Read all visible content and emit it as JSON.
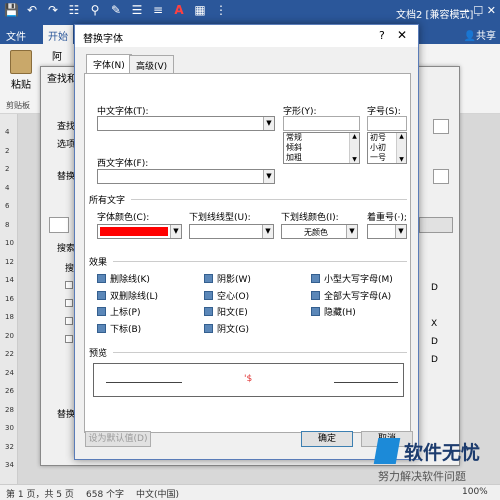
{
  "app": {
    "doc_title": "文档2 [兼容模式] -",
    "qat_icons": [
      "save-icon",
      "undo-icon",
      "redo-icon",
      "print-preview-icon",
      "zoom-icon",
      "format-painter-icon",
      "paragraph-icon",
      "align-icon",
      "font-color-icon",
      "table-icon",
      "more-icon"
    ],
    "font_color_glyph": "A",
    "menu_file": "文件",
    "menu_home": "开始",
    "share": "共享",
    "window_controls": "—  ☐  ✕"
  },
  "ribbon": {
    "paste_label": "粘贴",
    "group_label": "剪贴板",
    "font_hint": "阿"
  },
  "ruler_numbers": [
    "4",
    "2",
    "2",
    "4",
    "6",
    "8",
    "10",
    "12",
    "14",
    "16",
    "18",
    "20",
    "22",
    "24",
    "26",
    "28",
    "30",
    "32",
    "34"
  ],
  "status": {
    "page": "第 1 页，共 5 页",
    "words": "658 个字",
    "lang": "中文(中国)",
    "zoom": "100%"
  },
  "find_replace": {
    "title": "查找和",
    "find_label": "查找",
    "options_label": "选项",
    "replace_label": "替换",
    "search_label": "搜索",
    "search_sub": "搜",
    "replace_bottom": "替换",
    "right_letters": [
      "D",
      "X",
      "D",
      "D"
    ]
  },
  "dialog": {
    "title": "替换字体",
    "help": "?",
    "close": "✕",
    "tabs": [
      "字体(N)",
      "高级(V)"
    ],
    "chinese_font_label": "中文字体(T):",
    "chinese_font_value": "",
    "western_font_label": "西文字体(F):",
    "western_font_value": "",
    "style_label": "字形(Y):",
    "style_value": "",
    "style_options": [
      "常规",
      "倾斜",
      "加粗"
    ],
    "size_label": "字号(S):",
    "size_value": "",
    "size_options": [
      "初号",
      "小初",
      "一号"
    ],
    "all_text_label": "所有文字",
    "font_color_label": "字体颜色(C):",
    "font_color_value": "#ff0000",
    "underline_style_label": "下划线线型(U):",
    "underline_style_value": "",
    "underline_color_label": "下划线颜色(I):",
    "underline_color_value": "无颜色",
    "emphasis_label": "着重号(·);",
    "emphasis_value": "",
    "effects_label": "效果",
    "effects": [
      {
        "label": "删除线(K)",
        "col": 0,
        "row": 0
      },
      {
        "label": "双删除线(L)",
        "col": 0,
        "row": 1
      },
      {
        "label": "上标(P)",
        "col": 0,
        "row": 2
      },
      {
        "label": "下标(B)",
        "col": 0,
        "row": 3
      },
      {
        "label": "阴影(W)",
        "col": 1,
        "row": 0
      },
      {
        "label": "空心(O)",
        "col": 1,
        "row": 1
      },
      {
        "label": "阳文(E)",
        "col": 1,
        "row": 2
      },
      {
        "label": "阴文(G)",
        "col": 1,
        "row": 3
      },
      {
        "label": "小型大写字母(M)",
        "col": 2,
        "row": 0
      },
      {
        "label": "全部大写字母(A)",
        "col": 2,
        "row": 1
      },
      {
        "label": "隐藏(H)",
        "col": 2,
        "row": 2
      }
    ],
    "preview_label": "预览",
    "preview_sample": "'$",
    "set_default_btn": "设为默认值(D)",
    "ok_btn": "确定",
    "cancel_btn": "取消"
  },
  "watermark": {
    "main": "软件无忧",
    "sub": "努力解决软件问题"
  }
}
